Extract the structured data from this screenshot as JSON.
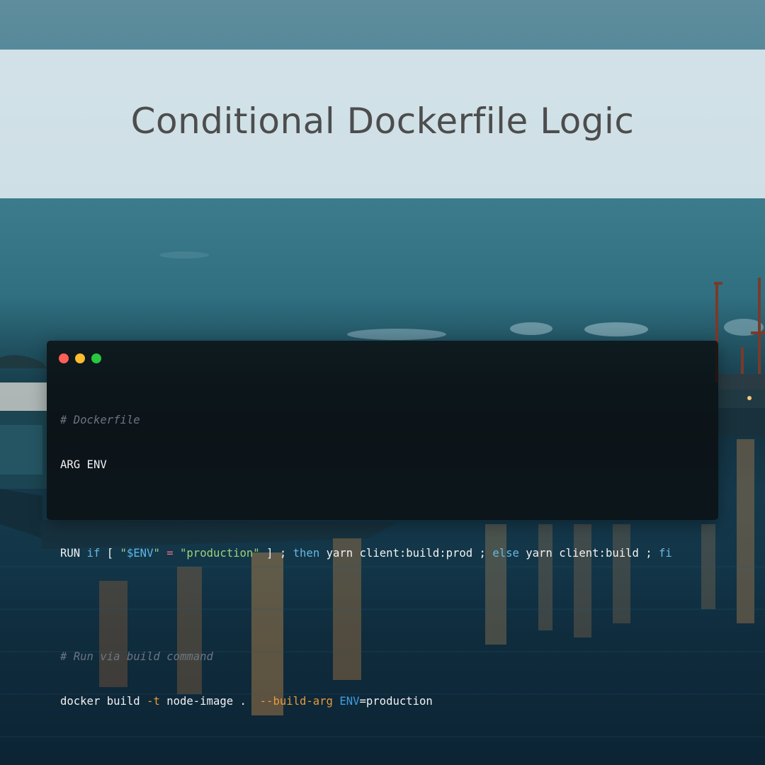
{
  "title": "Conditional Dockerfile Logic",
  "window_controls": [
    "close",
    "minimize",
    "maximize"
  ],
  "colors": {
    "close": "#ff5f57",
    "minimize": "#febc2e",
    "maximize": "#28c840",
    "comment": "#6c7580",
    "keyword": "#66b8e0",
    "string": "#9fd07a",
    "variable": "#5fb6e6",
    "operator": "#f06e86",
    "flag": "#e89b3a"
  },
  "code": {
    "comment1": "# Dockerfile",
    "line_arg": "ARG ENV",
    "run": {
      "t1": "RUN ",
      "t2": "if",
      "t3": " [ ",
      "t4": "\"",
      "t5": "$ENV",
      "t6": "\"",
      "t7": " ",
      "t8": "=",
      "t9": " ",
      "t10": "\"production\"",
      "t11": " ] ; ",
      "t12": "then",
      "t13": " yarn client:build:prod ; ",
      "t14": "else",
      "t15": " yarn client:build ; ",
      "t16": "fi"
    },
    "comment2": "# Run via build command",
    "build": {
      "t1": "docker build ",
      "t2": "-t",
      "t3": " node-image .  ",
      "t4": "--build-arg",
      "t5": " ",
      "t6": "ENV",
      "t7": "=production"
    }
  }
}
